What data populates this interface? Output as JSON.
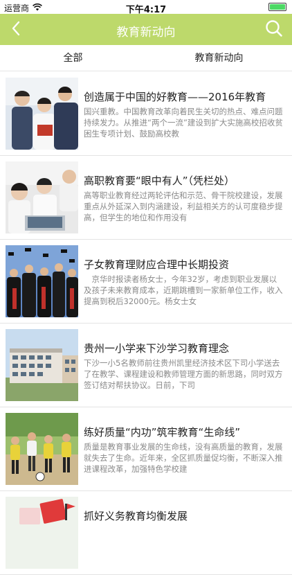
{
  "status": {
    "carrier": "运营商",
    "time": "下午4:17",
    "battery_level": 1.0
  },
  "navbar": {
    "title": "教育新动向",
    "back_icon": "chevron-left-icon",
    "search_icon": "search-icon"
  },
  "tabs": [
    {
      "label": "全部"
    },
    {
      "label": "教育新动向"
    }
  ],
  "articles": [
    {
      "title": "创造属于中国的好教育——2016年教育",
      "summary": "国兴重教。中国教育改革向着民生关切的热点、难点问题持续发力。从推进“两个一流”建设到扩大实施高校招收贫困生专项计划、鼓励高校教"
    },
    {
      "title": "高职教育要“眼中有人”（凭栏处）",
      "summary": "高等职业教育经过两轮评估和示范、骨干院校建设，发展重点从外延深入到内涵建设，利益相关方的认可度稳步提高，但学生的地位和作用没有"
    },
    {
      "title": "子女教育理财应合理中长期投资",
      "summary": "　京华时报读者杨女士，今年32岁，考虑到职业发展以及孩子未来教育成本，近期跳槽到一家新单位工作，收入提高到税后32000元。杨女士女"
    },
    {
      "title": "贵州一小学来下沙学习教育理念",
      "summary": "下沙一小5名教师前往贵州凯里经济技术区下司小学送去了在教学、课程建设和教师管理方面的新思路，同时双方签订结对帮扶协议。日前，下司"
    },
    {
      "title": "练好质量“内功”筑牢教育“生命线”",
      "summary": "质量是教育事业发展的生命线，没有高质量的教育，发展就失去了生命。近年来，全区抓质量促均衡，不断深入推进课程改革，加强特色学校建"
    },
    {
      "title": "抓好义务教育均衡发展",
      "summary": ""
    }
  ]
}
